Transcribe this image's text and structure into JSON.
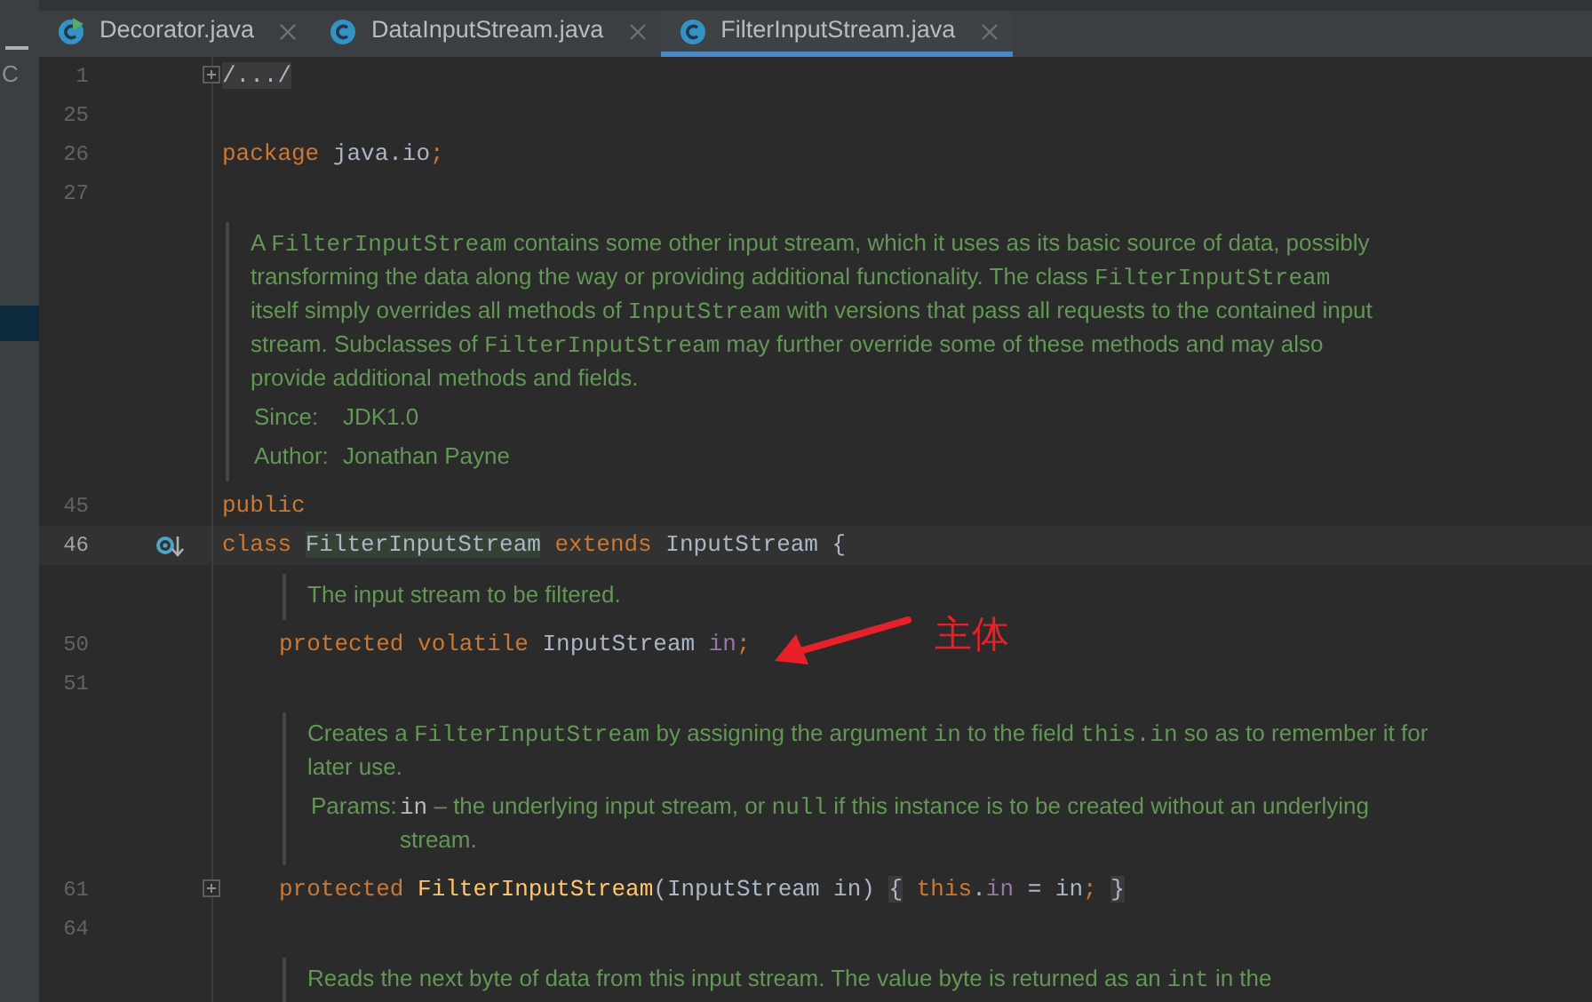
{
  "side_panel": {
    "rows": [
      {
        "label": "C",
        "selected": false
      },
      {
        "selected": true
      }
    ]
  },
  "tabs": [
    {
      "label": "Decorator.java",
      "selected": false,
      "runnable": true
    },
    {
      "label": "DataInputStream.java",
      "selected": false,
      "runnable": false
    },
    {
      "label": "FilterInputStream.java",
      "selected": true,
      "runnable": false
    }
  ],
  "editor": {
    "lines": [
      {
        "kind": "code",
        "number": "1",
        "fold": true,
        "current": false,
        "tokens": [
          {
            "text": "/.../",
            "kind": "folded"
          }
        ]
      },
      {
        "kind": "code",
        "number": "25",
        "fold": false,
        "current": false
      },
      {
        "kind": "code",
        "number": "26",
        "fold": false,
        "current": false,
        "tokens": [
          {
            "text": "package",
            "kind": "keyword"
          },
          {
            "text": " java.io",
            "kind": "plain"
          },
          {
            "text": ";",
            "kind": "keyword"
          }
        ]
      },
      {
        "kind": "code",
        "number": "27",
        "fold": false,
        "current": false
      },
      {
        "kind": "doc",
        "paragraph": [
          {
            "text": "A ",
            "kind": "text"
          },
          {
            "text": "FilterInputStream",
            "kind": "code"
          },
          {
            "text": " contains some other input stream, which it uses as its basic source of data, possibly transforming the data along the way or providing additional functionality. The class ",
            "kind": "text"
          },
          {
            "text": "FilterInputStream",
            "kind": "code"
          },
          {
            "text": " itself simply overrides all methods of ",
            "kind": "text"
          },
          {
            "text": "InputStream",
            "kind": "code"
          },
          {
            "text": " with versions that pass all requests to the contained input stream. Subclasses of ",
            "kind": "text"
          },
          {
            "text": "FilterInputStream",
            "kind": "code"
          },
          {
            "text": " may further override some of these methods and may also provide additional methods and fields.",
            "kind": "text"
          }
        ],
        "tags": [
          {
            "label": "Since:",
            "value": [
              {
                "text": "JDK1.0",
                "kind": "text"
              }
            ]
          },
          {
            "label": "Author:",
            "value": [
              {
                "text": "Jonathan Payne",
                "kind": "text"
              }
            ]
          }
        ]
      },
      {
        "kind": "code",
        "number": "45",
        "fold": false,
        "current": false,
        "tokens": [
          {
            "text": "public",
            "kind": "keyword"
          }
        ]
      },
      {
        "kind": "code",
        "number": "46",
        "fold": false,
        "current": true,
        "implemented_marker": true,
        "tokens": [
          {
            "text": "class ",
            "kind": "keyword"
          },
          {
            "text": "FilterInputStream",
            "kind": "highlight"
          },
          {
            "text": " extends",
            "kind": "keyword"
          },
          {
            "text": " InputStream {",
            "kind": "plain"
          }
        ],
        "children": [
          {
            "kind": "doc",
            "paragraph": [
              {
                "text": "The input stream to be filtered.",
                "kind": "text"
              }
            ]
          },
          {
            "kind": "code",
            "number": "50",
            "fold": false,
            "current": false,
            "tokens": [
              {
                "text": "protected volatile",
                "kind": "keyword"
              },
              {
                "text": " InputStream ",
                "kind": "plain"
              },
              {
                "text": "in",
                "kind": "field"
              },
              {
                "text": ";",
                "kind": "keyword"
              }
            ]
          },
          {
            "kind": "code",
            "number": "51",
            "fold": false,
            "current": false
          },
          {
            "kind": "doc",
            "paragraph": [
              {
                "text": "Creates a ",
                "kind": "text"
              },
              {
                "text": "FilterInputStream",
                "kind": "code"
              },
              {
                "text": " by assigning the argument ",
                "kind": "text"
              },
              {
                "text": "in",
                "kind": "code"
              },
              {
                "text": " to the field ",
                "kind": "text"
              },
              {
                "text": "this.in",
                "kind": "code"
              },
              {
                "text": " so as to remember it for later use.",
                "kind": "text"
              }
            ],
            "tags": [
              {
                "label": "Params:",
                "value": [
                  {
                    "text": "in",
                    "kind": "param"
                  },
                  {
                    "text": " – the underlying input stream, or ",
                    "kind": "text"
                  },
                  {
                    "text": "null",
                    "kind": "code"
                  },
                  {
                    "text": " if this instance is to be created without an underlying stream.",
                    "kind": "text"
                  }
                ]
              }
            ]
          },
          {
            "kind": "code",
            "number": "61",
            "fold": true,
            "current": false,
            "tokens": [
              {
                "text": "protected ",
                "kind": "keyword"
              },
              {
                "text": "FilterInputStream",
                "kind": "method"
              },
              {
                "text": "(InputStream in) ",
                "kind": "plain"
              },
              {
                "text": "{",
                "kind": "folded"
              },
              {
                "text": " this",
                "kind": "keyword"
              },
              {
                "text": ".",
                "kind": "plain"
              },
              {
                "text": "in",
                "kind": "field"
              },
              {
                "text": " = in",
                "kind": "plain"
              },
              {
                "text": "; ",
                "kind": "keyword"
              },
              {
                "text": "}",
                "kind": "folded"
              }
            ]
          },
          {
            "kind": "code",
            "number": "64",
            "fold": false,
            "current": false
          },
          {
            "kind": "doc",
            "paragraph": [
              {
                "text": "Reads the next byte of data from this input stream. The value byte is returned as an ",
                "kind": "text"
              },
              {
                "text": "int",
                "kind": "code"
              },
              {
                "text": " in the",
                "kind": "text"
              }
            ]
          }
        ]
      }
    ]
  },
  "annotation": {
    "label": "主体"
  }
}
